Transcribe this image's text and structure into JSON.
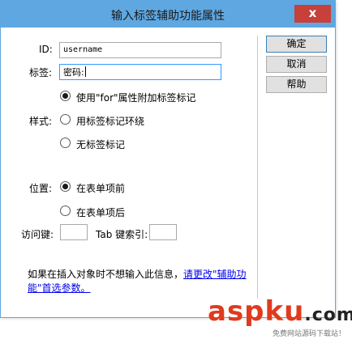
{
  "window": {
    "title": "输入标签辅助功能属性",
    "close_glyph": "x"
  },
  "form": {
    "id_label": "ID:",
    "id_value": "username",
    "tag_label": "标签:",
    "tag_value": "密码:",
    "style_label": "样式:",
    "style_options": [
      {
        "label": "使用\"for\"属性附加标签标记",
        "checked": true
      },
      {
        "label": "用标签标记环绕",
        "checked": false
      },
      {
        "label": "无标签标记",
        "checked": false
      }
    ],
    "position_label": "位置:",
    "position_options": [
      {
        "label": "在表单项前",
        "checked": true
      },
      {
        "label": "在表单项后",
        "checked": false
      }
    ],
    "access_key_label": "访问键:",
    "access_key_value": "",
    "tab_index_label": "Tab 键索引:",
    "tab_index_value": ""
  },
  "buttons": {
    "ok": "确定",
    "cancel": "取消",
    "help": "帮助"
  },
  "info": {
    "text": "如果在插入对象时不想输入此信息，",
    "link": "请更改\"辅助功能\"首选参数。"
  },
  "watermark": {
    "main_asp": "asp",
    "main_ku": "ku",
    "main_cn": ".com",
    "sub": "免费网站源码下载站！",
    "color": "#e03a1e"
  }
}
